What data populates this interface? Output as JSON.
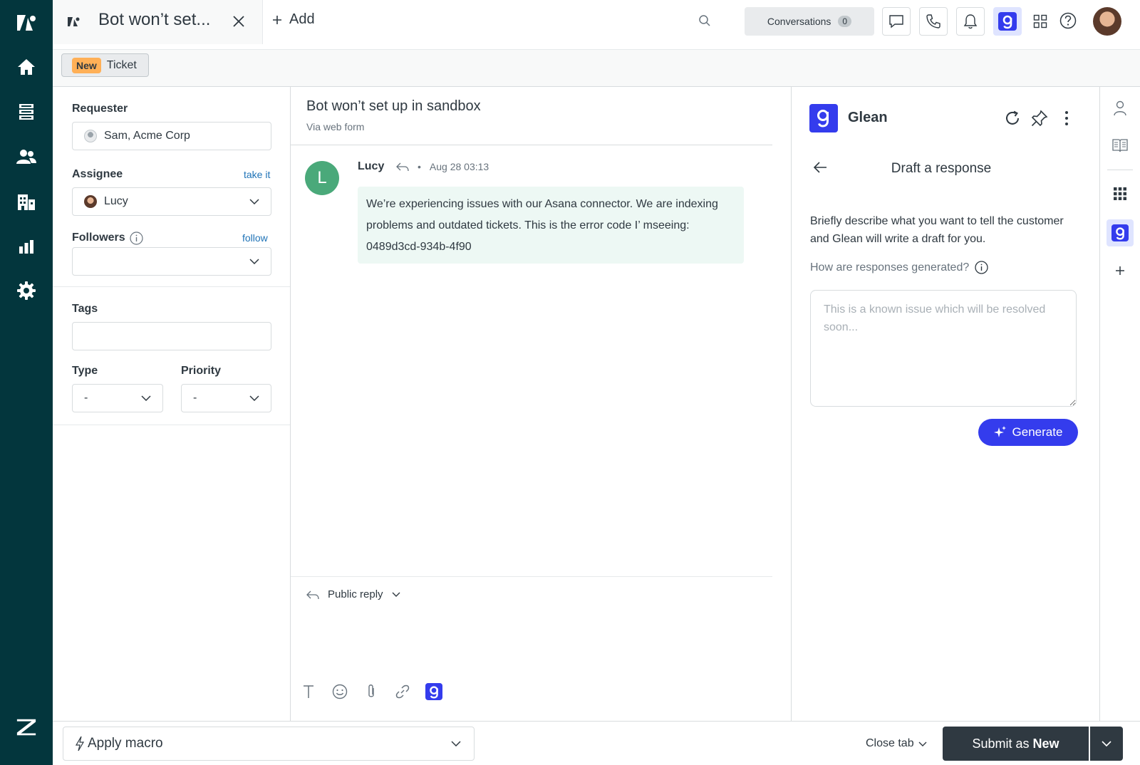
{
  "tab": {
    "title": "Bot won’t set...",
    "add_label": "Add"
  },
  "topbar": {
    "conversations_label": "Conversations",
    "conversations_count": "0"
  },
  "subheader": {
    "status_badge": "New",
    "ticket_label": "Ticket"
  },
  "props": {
    "requester_label": "Requester",
    "requester_value": "Sam, Acme Corp",
    "assignee_label": "Assignee",
    "assignee_link": "take it",
    "assignee_value": "Lucy",
    "followers_label": "Followers",
    "followers_link": "follow",
    "tags_label": "Tags",
    "type_label": "Type",
    "type_value": "-",
    "priority_label": "Priority",
    "priority_value": "-"
  },
  "conversation": {
    "title": "Bot won’t set up in sandbox",
    "channel": "Via web form",
    "message": {
      "avatar_initial": "L",
      "author": "Lucy",
      "timestamp": "Aug 28 03:13",
      "body": "We’re experiencing issues with our Asana connector. We are indexing problems and outdated tickets. This is the error code I’ mseeing: 0489d3cd-934b-4f90"
    },
    "reply_type": "Public reply"
  },
  "glean": {
    "name": "Glean",
    "subtitle": "Draft a response",
    "description": "Briefly describe what you want to tell the customer and Glean will write a draft for you.",
    "how_generated": "How are responses generated?",
    "placeholder": "This is a known issue which will be resolved soon...",
    "generate_label": "Generate",
    "brand_color": "#343ced"
  },
  "bottom": {
    "macro_label": "Apply macro",
    "close_tab_label": "Close tab",
    "submit_prefix": "Submit as",
    "submit_status": "New"
  },
  "colors": {
    "nav_bg": "#03363d",
    "new_badge": "#ffb057",
    "message_bg": "#edf8f4",
    "avatar_green": "#4aa97a"
  }
}
